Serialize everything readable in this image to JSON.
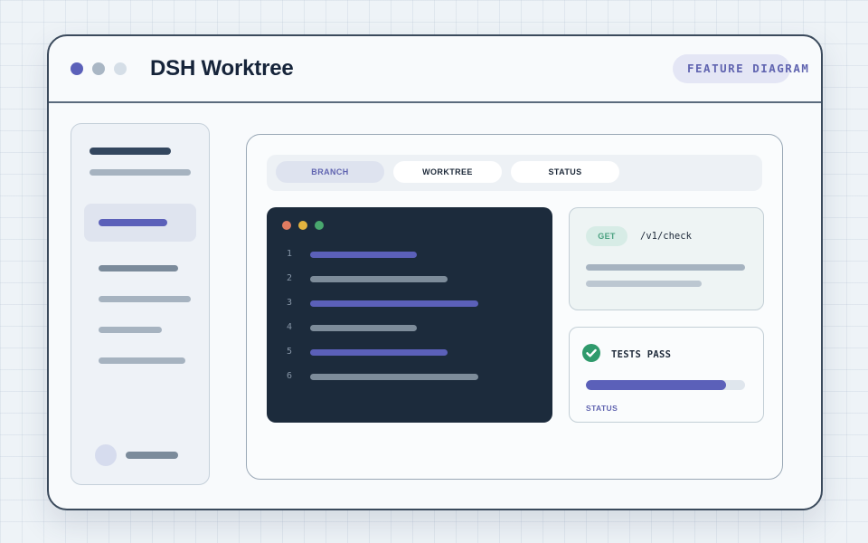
{
  "window": {
    "title": "DSH Worktree",
    "badge": "FEATURE DIAGRAM",
    "window_controls": [
      "primary-dot",
      "secondary-dot",
      "tertiary-dot"
    ]
  },
  "tabs": [
    {
      "label": "BRANCH",
      "active": true
    },
    {
      "label": "WORKTREE",
      "active": false
    },
    {
      "label": "STATUS",
      "active": false
    }
  ],
  "code": {
    "line_numbers": [
      "1",
      "2",
      "3",
      "4",
      "5",
      "6"
    ]
  },
  "api": {
    "method": "GET",
    "endpoint": "/v1/check"
  },
  "tests": {
    "label": "TESTS PASS",
    "status_label": "STATUS",
    "progress_percent": 88
  },
  "icons": {
    "check": "check-circle-icon",
    "avatar": "avatar"
  },
  "colors": {
    "accent": "#5b60b9",
    "code_bg": "#1c2b3c",
    "success": "#2f9a6c",
    "dot_red": "#e07b61",
    "dot_yellow": "#e2b33f",
    "dot_green": "#49a86e"
  }
}
